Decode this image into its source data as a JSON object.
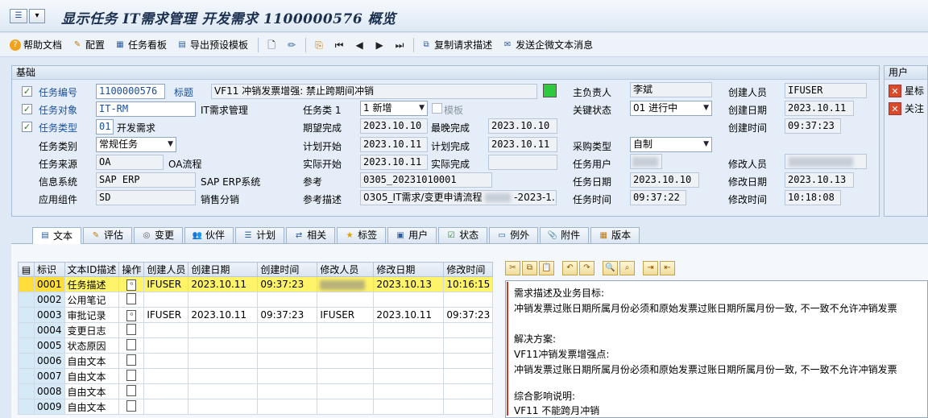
{
  "window": {
    "title": "显示任务 IT需求管理 开发需求 1100000576 概览",
    "menu_icon": "sap-menu-icon",
    "dropdown_glyph": "▾"
  },
  "toolbar": {
    "items": [
      {
        "label": "帮助文档",
        "icon": "help-icon"
      },
      {
        "label": "配置",
        "icon": "edit-icon"
      },
      {
        "label": "任务看板",
        "icon": "board-icon"
      },
      {
        "label": "导出预设模板",
        "icon": "export-icon"
      }
    ],
    "copy_label": "复制请求描述",
    "send_label": "发送企微文本消息"
  },
  "basic": {
    "header": "基础",
    "task_no_label": "任务编号",
    "task_no": "1100000576",
    "title_label": "标题",
    "title_value": "VF11 冲销发票增强: 禁止跨期间冲销",
    "object_label": "任务对象",
    "object_value": "IT-RM",
    "object_desc": "IT需求管理",
    "type_label": "任务类型",
    "type_value": "01",
    "type_desc": "开发需求",
    "category_label": "任务类别",
    "category_value": "常规任务",
    "source_label": "任务来源",
    "source_value": "OA",
    "source_desc": "OA流程",
    "system_label": "信息系统",
    "system_value": "SAP ERP",
    "system_desc": "SAP ERP系统",
    "component_label": "应用组件",
    "component_value": "SD",
    "component_desc": "销售分销",
    "class1_label": "任务类 1",
    "class1_value": "1 新增",
    "template_label": "模板",
    "expect_done_label": "期望完成",
    "expect_done": "2023.10.10",
    "latest_done_label": "最晚完成",
    "latest_done": "2023.10.10",
    "plan_start_label": "计划开始",
    "plan_start": "2023.10.11",
    "plan_done_label": "计划完成",
    "plan_done": "2023.10.11",
    "actual_start_label": "实际开始",
    "actual_start": "2023.10.11",
    "actual_done_label": "实际完成",
    "actual_done": "",
    "ref_label": "参考",
    "ref_value": "0305_20231010001",
    "ref_desc_label": "参考描述",
    "ref_desc_value": "0305_IT需求/变更申请流程",
    "ref_desc_tail": "-2023-1...",
    "owner_label": "主负责人",
    "owner_value": "李斌",
    "status_label": "关键状态",
    "status_value": "01 进行中",
    "purchase_label": "采购类型",
    "purchase_value": "自制",
    "task_user_label": "任务用户",
    "task_date_label": "任务日期",
    "task_date": "2023.10.10",
    "task_time_label": "任务时间",
    "task_time": "09:37:22",
    "creator_label": "创建人员",
    "creator_value": "IFUSER",
    "create_date_label": "创建日期",
    "create_date": "2023.10.11",
    "create_time_label": "创建时间",
    "create_time": "09:37:23",
    "modifier_label": "修改人员",
    "modify_date_label": "修改日期",
    "modify_date": "2023.10.13",
    "modify_time_label": "修改时间",
    "modify_time": "10:18:08"
  },
  "user_panel": {
    "header": "用户",
    "star_label": "星标",
    "follow_label": "关注"
  },
  "tabs": [
    {
      "label": "文本",
      "icon": "text-icon"
    },
    {
      "label": "评估",
      "icon": "evaluate-icon"
    },
    {
      "label": "变更",
      "icon": "change-icon"
    },
    {
      "label": "伙伴",
      "icon": "partner-icon"
    },
    {
      "label": "计划",
      "icon": "plan-icon"
    },
    {
      "label": "相关",
      "icon": "related-icon"
    },
    {
      "label": "标签",
      "icon": "star-icon"
    },
    {
      "label": "用户",
      "icon": "user-icon"
    },
    {
      "label": "状态",
      "icon": "status-icon"
    },
    {
      "label": "例外",
      "icon": "exception-icon"
    },
    {
      "label": "附件",
      "icon": "attachment-icon"
    },
    {
      "label": "版本",
      "icon": "version-icon"
    }
  ],
  "text_table": {
    "columns": [
      "标识",
      "文本ID描述",
      "操作",
      "创建人员",
      "创建日期",
      "创建时间",
      "修改人员",
      "修改日期",
      "修改时间"
    ],
    "rows": [
      {
        "id": "0001",
        "desc": "任务描述",
        "creator": "IFUSER",
        "cdate": "2023.10.11",
        "ctime": "09:37:23",
        "modifier": "",
        "mdate": "2023.10.13",
        "mtime": "10:16:15"
      },
      {
        "id": "0002",
        "desc": "公用笔记",
        "creator": "",
        "cdate": "",
        "ctime": "",
        "modifier": "",
        "mdate": "",
        "mtime": ""
      },
      {
        "id": "0003",
        "desc": "审批记录",
        "creator": "IFUSER",
        "cdate": "2023.10.11",
        "ctime": "09:37:23",
        "modifier": "IFUSER",
        "mdate": "2023.10.11",
        "mtime": "09:37:23"
      },
      {
        "id": "0004",
        "desc": "变更日志",
        "creator": "",
        "cdate": "",
        "ctime": "",
        "modifier": "",
        "mdate": "",
        "mtime": ""
      },
      {
        "id": "0005",
        "desc": "状态原因",
        "creator": "",
        "cdate": "",
        "ctime": "",
        "modifier": "",
        "mdate": "",
        "mtime": ""
      },
      {
        "id": "0006",
        "desc": "自由文本",
        "creator": "",
        "cdate": "",
        "ctime": "",
        "modifier": "",
        "mdate": "",
        "mtime": ""
      },
      {
        "id": "0007",
        "desc": "自由文本",
        "creator": "",
        "cdate": "",
        "ctime": "",
        "modifier": "",
        "mdate": "",
        "mtime": ""
      },
      {
        "id": "0008",
        "desc": "自由文本",
        "creator": "",
        "cdate": "",
        "ctime": "",
        "modifier": "",
        "mdate": "",
        "mtime": ""
      },
      {
        "id": "0009",
        "desc": "自由文本",
        "creator": "",
        "cdate": "",
        "ctime": "",
        "modifier": "",
        "mdate": "",
        "mtime": ""
      }
    ]
  },
  "editor": {
    "lines": [
      "需求描述及业务目标:",
      "冲销发票过账日期所属月份必须和原始发票过账日期所属月份一致, 不一致不允许冲销发票",
      "",
      "解决方案:",
      "VF11冲销发票增强点:",
      "冲销发票过账日期所属月份必须和原始发票过账日期所属月份一致, 不一致不允许冲销发票",
      "",
      "综合影响说明:",
      "VF11 不能跨月冲销"
    ]
  }
}
